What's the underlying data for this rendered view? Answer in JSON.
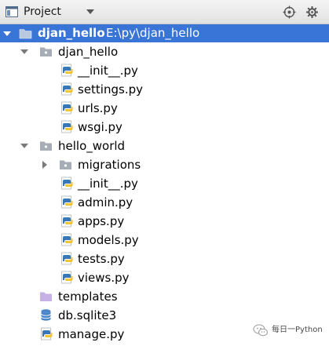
{
  "header": {
    "title": "Project",
    "title_icon": "project-window-icon",
    "dropdown_icon": "triangle-down-icon",
    "buttons": [
      "crosshair-locate-icon",
      "settings-split-icon"
    ]
  },
  "tree": {
    "root": {
      "name": "djan_hello",
      "path": "E:\\py\\djan_hello"
    },
    "djan_hello_pkg": {
      "name": "djan_hello",
      "files": [
        "__init__.py",
        "settings.py",
        "urls.py",
        "wsgi.py"
      ]
    },
    "hello_world_pkg": {
      "name": "hello_world",
      "migrations": "migrations",
      "files": [
        "__init__.py",
        "admin.py",
        "apps.py",
        "models.py",
        "tests.py",
        "views.py"
      ]
    },
    "templates": "templates",
    "db": "db.sqlite3",
    "manage": "manage.py"
  },
  "watermark": {
    "text": "每日一Python"
  },
  "colors": {
    "selection": "#3875d7",
    "python_blue": "#3b77b5",
    "python_yellow": "#f2c531",
    "folder_gray": "#a6adb6",
    "templates_purple": "#c7b2e6",
    "db_blue": "#4a85c9"
  }
}
